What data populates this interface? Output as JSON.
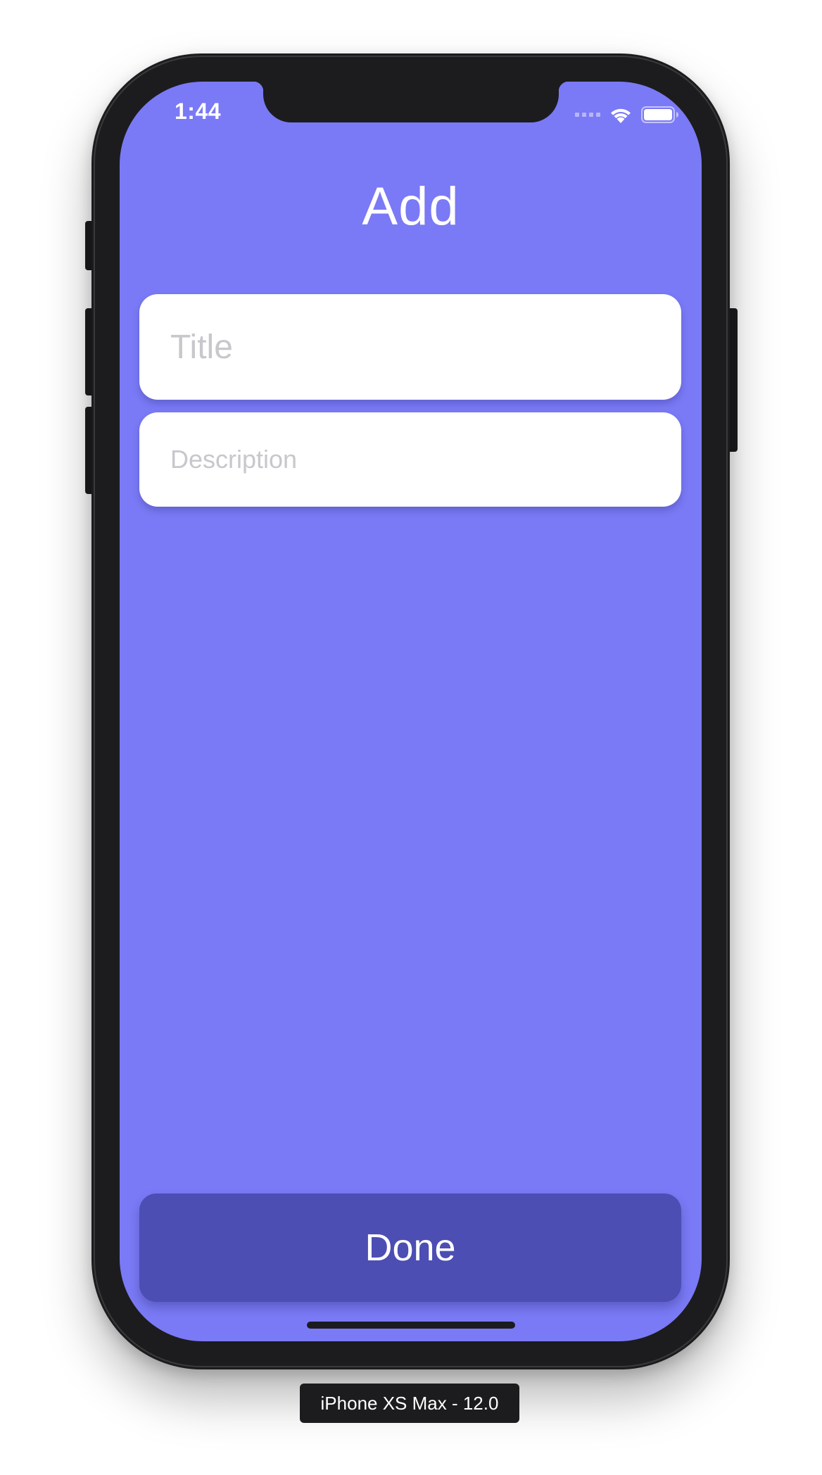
{
  "status_bar": {
    "time": "1:44",
    "signal_icon": "cellular-signal-icon",
    "wifi_icon": "wifi-icon",
    "battery_icon": "battery-icon"
  },
  "screen": {
    "title": "Add",
    "background_color": "#7a7af6"
  },
  "form": {
    "title_field": {
      "value": "",
      "placeholder": "Title"
    },
    "description_field": {
      "value": "",
      "placeholder": "Description"
    },
    "done_label": "Done",
    "done_color": "#4c4eb4"
  },
  "simulator": {
    "device_label": "iPhone XS Max - 12.0"
  }
}
